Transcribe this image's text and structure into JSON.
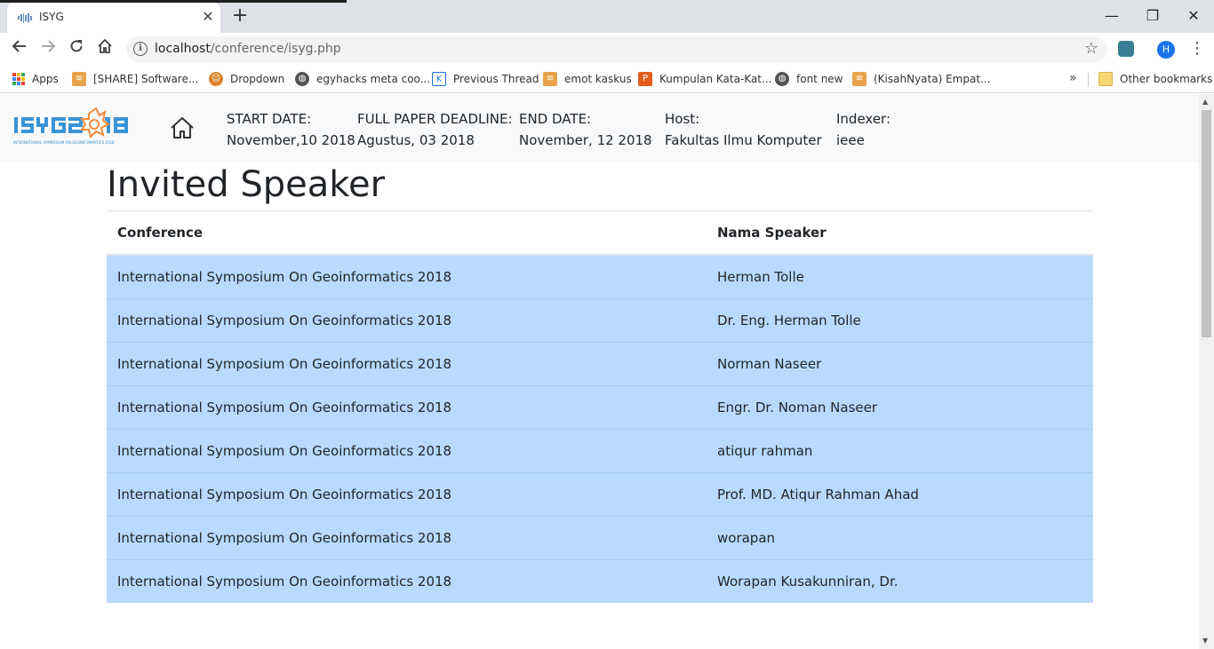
{
  "browser": {
    "tab_title": "ISYG",
    "tab_close": "✕",
    "new_tab": "+",
    "url_host": "localhost",
    "url_path": "/conference/isyg.php",
    "profile_initial": "H",
    "win_minimize": "—",
    "win_restore": "❐",
    "win_close": "✕",
    "bookmarks": [
      {
        "label": "Apps",
        "icon": "apps-grid-icon",
        "color": "#4285f4"
      },
      {
        "label": "[SHARE] Software...",
        "icon": "kaskus-icon",
        "color": "#e8a34a"
      },
      {
        "label": "Dropdown",
        "icon": "person-icon",
        "color": "#d9822b"
      },
      {
        "label": "egyhacks meta coo...",
        "icon": "globe-icon",
        "color": "#555555"
      },
      {
        "label": "Previous Thread",
        "icon": "kaskus-k-icon",
        "color": "#1a73e8"
      },
      {
        "label": "emot kaskus",
        "icon": "kaskus-icon",
        "color": "#e8a34a"
      },
      {
        "label": "Kumpulan Kata-Kat...",
        "icon": "p-icon",
        "color": "#e25c1c"
      },
      {
        "label": "font new",
        "icon": "globe-icon",
        "color": "#555555"
      },
      {
        "label": "(KisahNyata) Empat...",
        "icon": "kaskus-icon",
        "color": "#e8a34a"
      }
    ],
    "bookmarks_overflow": "»",
    "other_bookmarks": "Other bookmarks"
  },
  "site": {
    "logo_text": "ISYG2018",
    "logo_subtitle": "INTERNATIONAL SYMPOSIUM ON GEOINFORMATICS 2018",
    "info": [
      {
        "label": "START DATE:",
        "value": "November,10 2018"
      },
      {
        "label": "FULL PAPER DEADLINE:",
        "value": "Agustus, 03 2018"
      },
      {
        "label": "END DATE:",
        "value": "November, 12 2018"
      },
      {
        "label": "Host:",
        "value": "Fakultas Ilmu Komputer"
      },
      {
        "label": "Indexer:",
        "value": "ieee"
      }
    ]
  },
  "page": {
    "title": "Invited Speaker",
    "columns": [
      "Conference",
      "Nama Speaker"
    ],
    "rows": [
      [
        "International Symposium On Geoinformatics 2018",
        "Herman Tolle"
      ],
      [
        "International Symposium On Geoinformatics 2018",
        "Dr. Eng. Herman Tolle"
      ],
      [
        "International Symposium On Geoinformatics 2018",
        "Norman Naseer"
      ],
      [
        "International Symposium On Geoinformatics 2018",
        "Engr. Dr. Noman Naseer"
      ],
      [
        "International Symposium On Geoinformatics 2018",
        "atiqur rahman"
      ],
      [
        "International Symposium On Geoinformatics 2018",
        "Prof. MD. Atiqur Rahman Ahad"
      ],
      [
        "International Symposium On Geoinformatics 2018",
        "worapan"
      ],
      [
        "International Symposium On Geoinformatics 2018",
        "Worapan Kusakunniran, Dr."
      ]
    ]
  },
  "colors": {
    "row_bg": "#b8daff",
    "header_bg": "#f8f9fa",
    "logo_blue": "#3a93d6",
    "logo_orange": "#f08a3c"
  }
}
